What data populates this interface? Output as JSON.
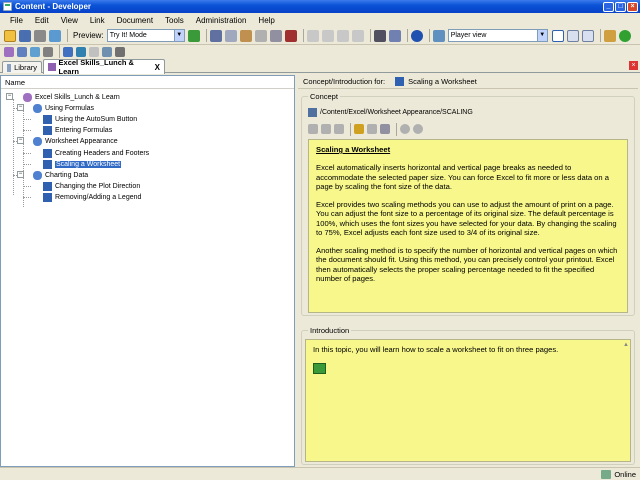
{
  "window": {
    "title": "Content - Developer"
  },
  "menu": [
    "File",
    "Edit",
    "View",
    "Link",
    "Document",
    "Tools",
    "Administration",
    "Help"
  ],
  "toolbar": {
    "preview_label": "Preview:",
    "preview_mode": "Try It! Mode",
    "view_mode": "Player view"
  },
  "tabs": {
    "library": "Library",
    "outline": "Excel Skills_Lunch & Learn",
    "close_symbol": "X"
  },
  "tree": {
    "header": "Name",
    "items": [
      "Excel Skills_Lunch & Learn",
      "Using Formulas",
      "Using the AutoSum Button",
      "Entering Formulas",
      "Worksheet Appearance",
      "Creating Headers and Footers",
      "Scaling a Worksheet",
      "Charting Data",
      "Changing the Plot Direction",
      "Removing/Adding a Legend"
    ]
  },
  "concept_for": {
    "label": "Concept/Introduction for:",
    "topic": "Scaling a Worksheet"
  },
  "concept": {
    "legend": "Concept",
    "path": "/Content/Excel/Worksheet Appearance/SCALING",
    "heading": "Scaling a Worksheet",
    "paragraphs": [
      "Excel automatically inserts horizontal and vertical page breaks as needed to accommodate the selected paper size. You can force Excel to fit more or less data on a page by scaling the font size of the data.",
      "Excel provides two scaling methods you can use to adjust the amount of print on a page. You can adjust the font size to a percentage of its original size. The default percentage is 100%, which uses the font sizes you have selected for your data. By changing the scaling to 75%, Excel adjusts each font size used to 3/4 of its original size.",
      "Another scaling method is to specify the number of horizontal and vertical pages on which the document should fit. Using this method, you can precisely control your printout. Excel then automatically selects the proper scaling percentage needed to fit the specified number of pages."
    ]
  },
  "introduction": {
    "legend": "Introduction",
    "text": "In this topic, you will learn how to scale a worksheet to fit on three pages."
  },
  "status": {
    "text": "Online"
  },
  "colors": {
    "concept_bg": "#f7f78c",
    "selection": "#316ac5",
    "titlebar": "#0a52d6"
  }
}
